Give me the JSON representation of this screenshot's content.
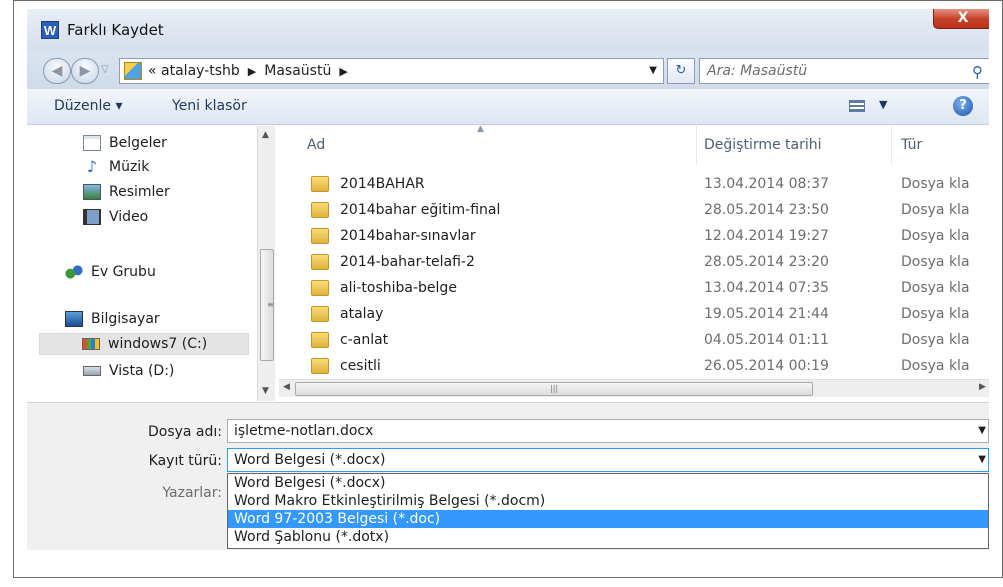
{
  "window": {
    "title": "Farklı Kaydet",
    "app_icon": "W",
    "close_label": "X"
  },
  "address": {
    "back_icon": "back-arrow-icon",
    "forward_icon": "forward-arrow-icon",
    "breadcrumb_prefix": "«",
    "breadcrumb": [
      "atalay-tshb",
      "Masaüstü"
    ],
    "search_placeholder": "Ara: Masaüstü"
  },
  "toolbar": {
    "organize_label": "Düzenle ▾",
    "new_folder_label": "Yeni klasör",
    "help_label": "?"
  },
  "navigation": {
    "items": [
      {
        "label": "Belgeler",
        "icon": "document-icon"
      },
      {
        "label": "Müzik",
        "icon": "music-icon"
      },
      {
        "label": "Resimler",
        "icon": "pictures-icon"
      },
      {
        "label": "Video",
        "icon": "video-icon"
      },
      {
        "label": "Ev Grubu",
        "icon": "homegroup-icon"
      },
      {
        "label": "Bilgisayar",
        "icon": "computer-icon"
      },
      {
        "label": "windows7 (C:)",
        "icon": "windows-drive-icon",
        "selected": true
      },
      {
        "label": "Vista (D:)",
        "icon": "drive-icon"
      }
    ]
  },
  "file_list": {
    "columns": [
      "Ad",
      "Değiştirme tarihi",
      "Tür"
    ],
    "rows": [
      {
        "name": "2014BAHAR",
        "date": "13.04.2014 08:37",
        "type": "Dosya kla"
      },
      {
        "name": "2014bahar eğitim-final",
        "date": "28.05.2014 23:50",
        "type": "Dosya kla"
      },
      {
        "name": "2014bahar-sınavlar",
        "date": "12.04.2014 19:27",
        "type": "Dosya kla"
      },
      {
        "name": "2014-bahar-telafi-2",
        "date": "28.05.2014 23:20",
        "type": "Dosya kla"
      },
      {
        "name": "ali-toshiba-belge",
        "date": "13.04.2014 07:35",
        "type": "Dosya kla"
      },
      {
        "name": "atalay",
        "date": "19.05.2014 21:44",
        "type": "Dosya kla"
      },
      {
        "name": "c-anlat",
        "date": "04.05.2014 01:11",
        "type": "Dosya kla"
      },
      {
        "name": "cesitli",
        "date": "26.05.2014 00:19",
        "type": "Dosya kla"
      }
    ]
  },
  "form": {
    "filename_label": "Dosya adı:",
    "filename_value": "işletme-notları.docx",
    "filetype_label": "Kayıt türü:",
    "filetype_value": "Word Belgesi (*.docx)",
    "authors_label": "Yazarlar:",
    "filetype_options": [
      {
        "label": "Word Belgesi (*.docx)",
        "highlighted": false
      },
      {
        "label": "Word Makro Etkinleştirilmiş Belgesi (*.docm)",
        "highlighted": false
      },
      {
        "label": "Word 97-2003 Belgesi (*.doc)",
        "highlighted": true
      },
      {
        "label": "Word Şablonu (*.dotx)",
        "highlighted": false
      }
    ]
  },
  "colors": {
    "selection": "#3399ff",
    "titlebar": "#dbe4f0",
    "close_button": "#c8412b",
    "folder": "#e0b23a"
  }
}
